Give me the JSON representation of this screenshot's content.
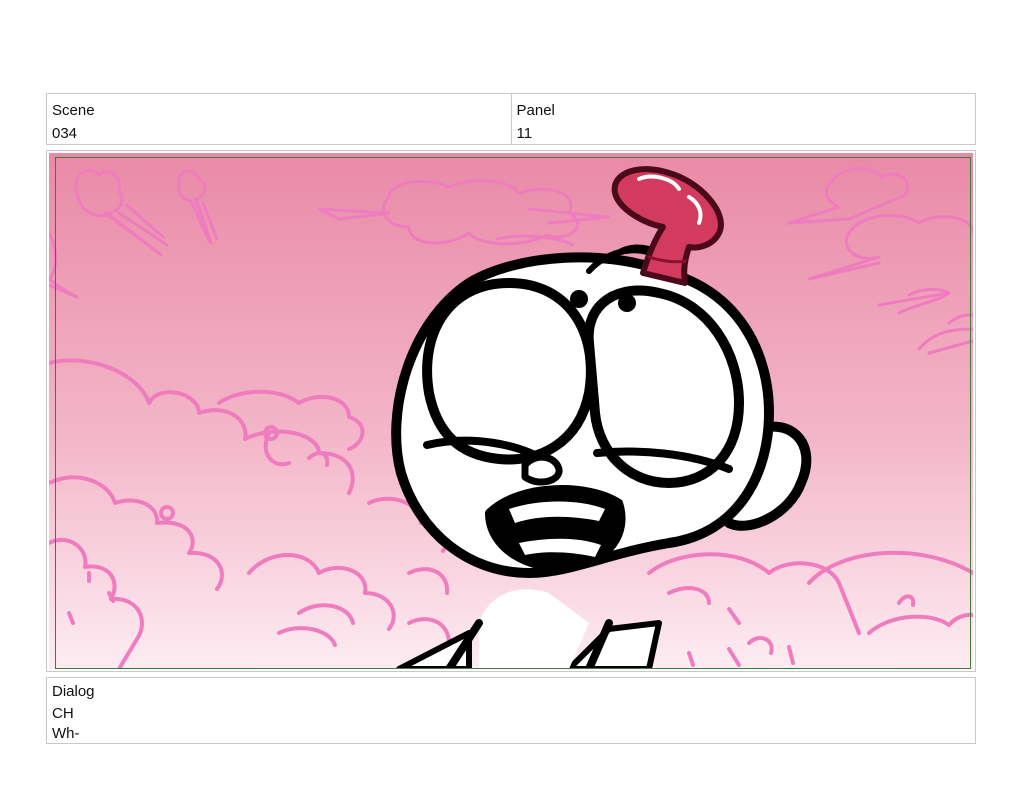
{
  "header": {
    "scene_label": "Scene",
    "scene_value": "034",
    "panel_label": "Panel",
    "panel_value": "11"
  },
  "dialog": {
    "label": "Dialog",
    "character": "CH",
    "line": "Wh-"
  },
  "colors": {
    "sky_top": "#e98aa6",
    "sky_bottom": "#fde8ee",
    "cloud_line": "#f07cc0",
    "ink": "#000000",
    "candy": "#d23a5e",
    "safe_frame": "#3f7a3a",
    "cell_border": "#c8c8c8"
  },
  "panel": {
    "icons": [
      "storyboard-drawing"
    ]
  }
}
